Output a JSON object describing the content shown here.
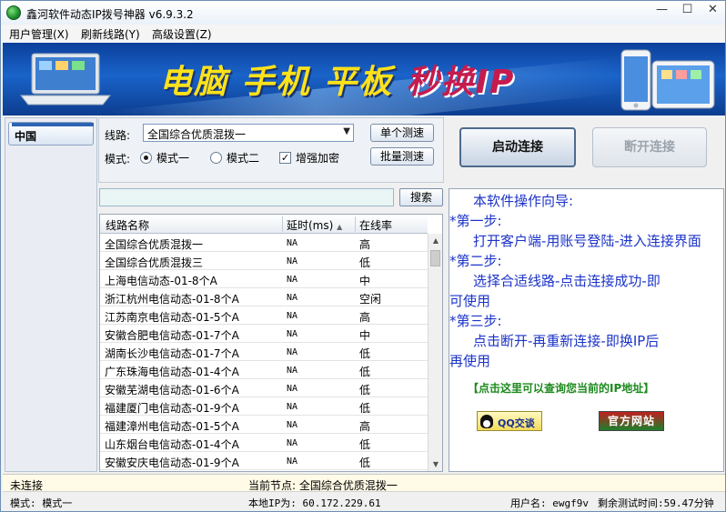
{
  "window": {
    "title": "鑫河软件动态IP拨号神器 v6.9.3.2",
    "minimize_glyph": "—",
    "maximize_glyph": "☐",
    "close_glyph": "✕"
  },
  "menu": [
    "用户管理(X)",
    "刷新线路(Y)",
    "高级设置(Z)"
  ],
  "banner": {
    "slogan_part1": "电脑 手机 平板",
    "slogan_part2": "秒换IP"
  },
  "countries": [
    "中国"
  ],
  "controls": {
    "route_label": "线路:",
    "route_value": "全国综合优质混拨一",
    "mode_label": "模式:",
    "mode1_label": "模式一",
    "mode2_label": "模式二",
    "mode_selected": "模式一",
    "encrypt_label": "增强加密",
    "encrypt_checked": true,
    "single_test_label": "单个测速",
    "batch_test_label": "批量测速",
    "start_label": "启动连接",
    "stop_label": "断开连接"
  },
  "search": {
    "value": "",
    "button_label": "搜索"
  },
  "table": {
    "columns": [
      "线路名称",
      "延时(ms)",
      "在线率"
    ],
    "rows": [
      {
        "name": "全国综合优质混拨一",
        "latency": "NA",
        "rate": "高"
      },
      {
        "name": "全国综合优质混拨三",
        "latency": "NA",
        "rate": "低"
      },
      {
        "name": "上海电信动态-01-8个A",
        "latency": "NA",
        "rate": "中"
      },
      {
        "name": "浙江杭州电信动态-01-8个A",
        "latency": "NA",
        "rate": "空闲"
      },
      {
        "name": "江苏南京电信动态-01-5个A",
        "latency": "NA",
        "rate": "高"
      },
      {
        "name": "安徽合肥电信动态-01-7个A",
        "latency": "NA",
        "rate": "中"
      },
      {
        "name": "湖南长沙电信动态-01-7个A",
        "latency": "NA",
        "rate": "低"
      },
      {
        "name": "广东珠海电信动态-01-4个A",
        "latency": "NA",
        "rate": "低"
      },
      {
        "name": "安徽芜湖电信动态-01-6个A",
        "latency": "NA",
        "rate": "低"
      },
      {
        "name": "福建厦门电信动态-01-9个A",
        "latency": "NA",
        "rate": "低"
      },
      {
        "name": "福建漳州电信动态-01-5个A",
        "latency": "NA",
        "rate": "高"
      },
      {
        "name": "山东烟台电信动态-01-4个A",
        "latency": "NA",
        "rate": "低"
      },
      {
        "name": "安徽安庆电信动态-01-9个A",
        "latency": "NA",
        "rate": "低"
      }
    ]
  },
  "guide": {
    "lines": [
      "本软件操作向导:",
      "*第一步:",
      "打开客户端-用账号登陆-进入连接界面",
      "*第二步:",
      "选择合适线路-点击连接成功-即",
      "可使用",
      "*第三步:",
      "点击断开-再重新连接-即换IP后",
      "再使用"
    ],
    "ip_link": "【点击这里可以查询您当前的IP地址】",
    "qq_label": "QQ交谈",
    "site_label": "官方网站"
  },
  "status": {
    "connection": "未连接",
    "current_node": "当前节点: 全国综合优质混拨一",
    "mode": "模式: 模式一",
    "local_ip": "本地IP为: 60.172.229.61",
    "user": "用户名: ewgf9v",
    "remaining": "剩余测试时间:59.47分钟"
  },
  "colors": {
    "banner_blue": "#1a63c9",
    "slogan_yellow": "#ffe21a",
    "slogan_red": "#c51b4d",
    "guide_text": "#1b33c7",
    "ip_link": "#1d8a1d"
  }
}
